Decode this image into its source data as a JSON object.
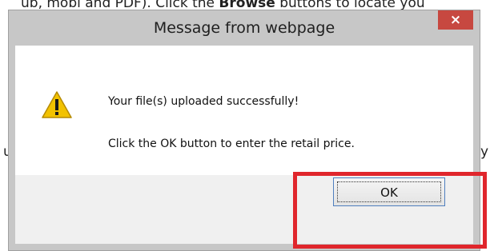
{
  "background": {
    "top_text_prefix": "ub, mobi and PDF). Click the ",
    "top_text_bold": "Browse",
    "top_text_suffix": " buttons to locate you",
    "left_fragment": "u",
    "right_fragment": "y"
  },
  "dialog": {
    "title": "Message from webpage",
    "close_label": "×",
    "icon": "warning-icon",
    "message_line_1": "Your file(s) uploaded successfully!",
    "message_line_2": "Click the OK button to enter the retail price.",
    "ok_label": "OK"
  },
  "colors": {
    "highlight": "#e0262c",
    "close_button": "#c74840",
    "warning_yellow": "#f2c200"
  }
}
